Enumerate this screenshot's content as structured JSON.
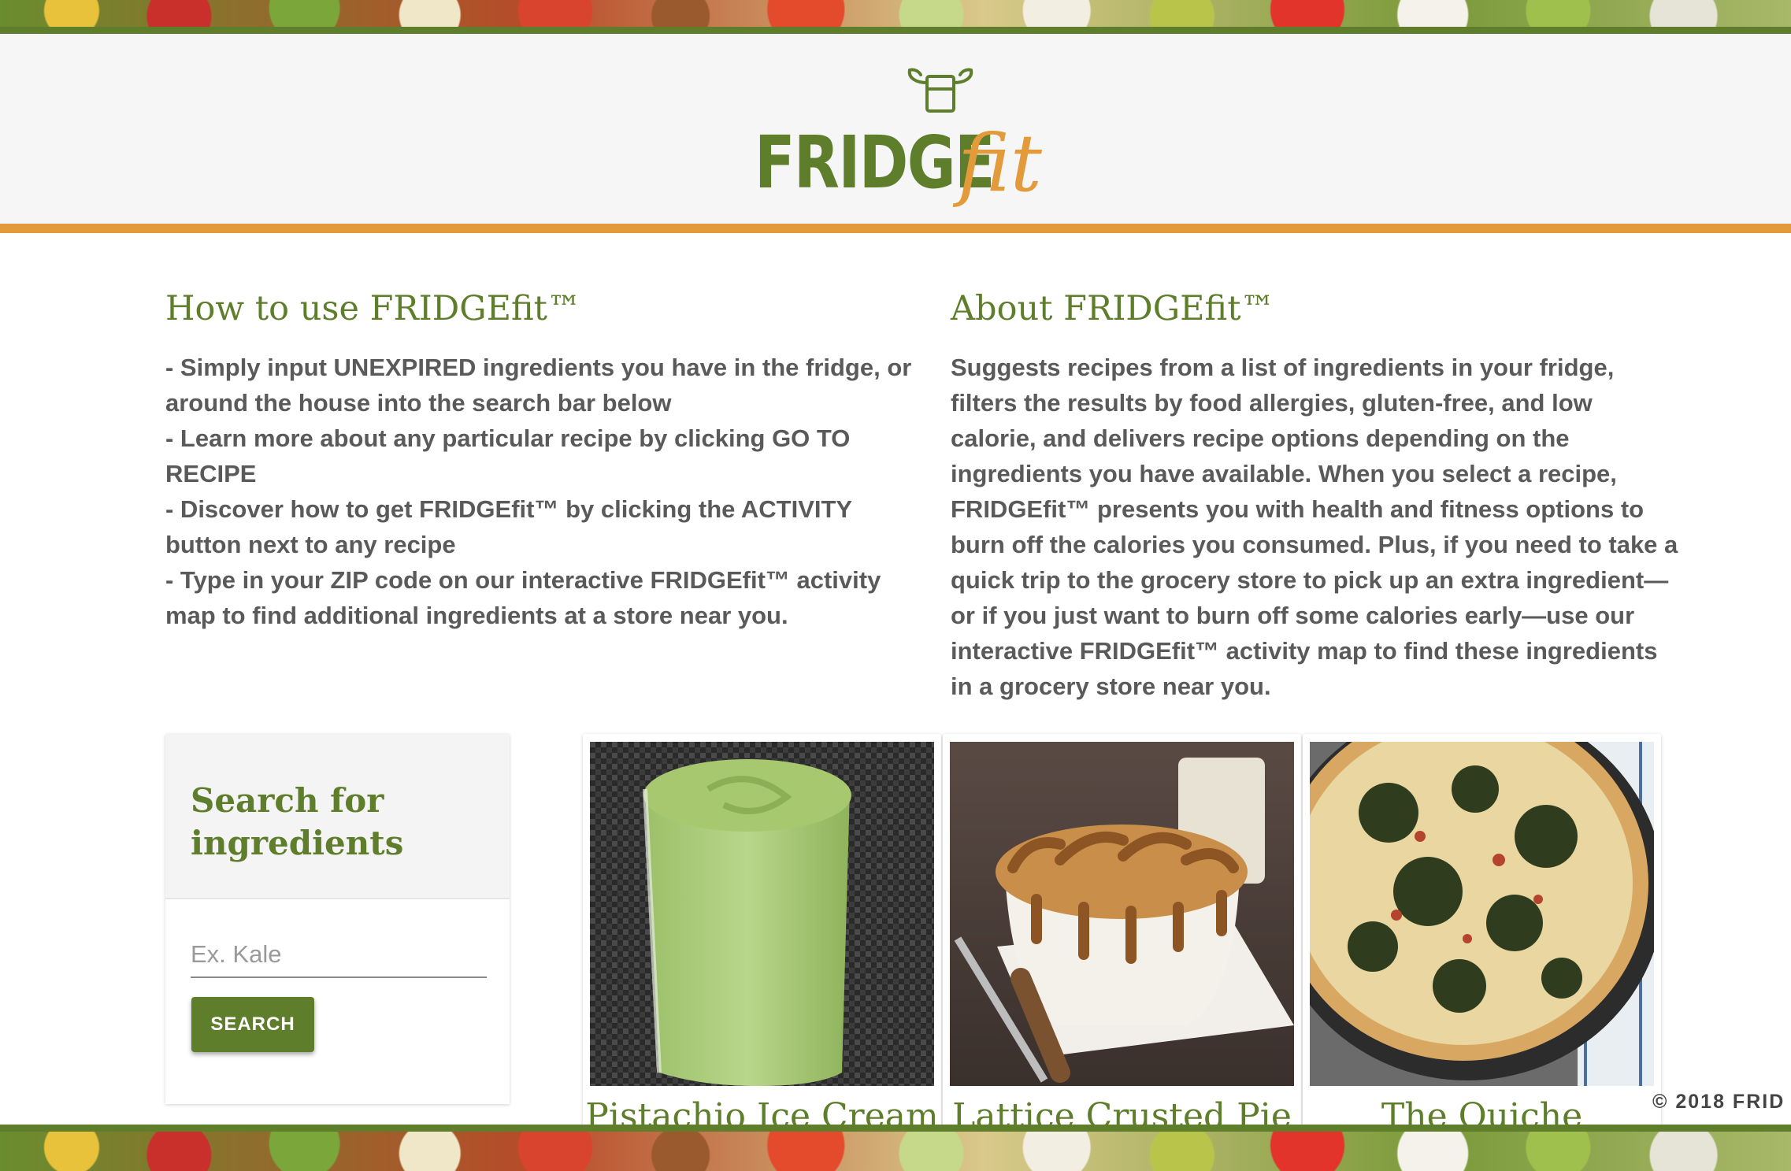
{
  "header": {
    "logo_text_main": "FRIDGE",
    "logo_text_accent": "fit"
  },
  "how_to": {
    "title": "How to use FRIDGEfit™",
    "lines": [
      "- Simply input UNEXPIRED ingredients you have in the fridge, or around the house into the search bar below",
      "- Learn more about any particular recipe by clicking GO TO RECIPE",
      "- Discover how to get FRIDGEfit™ by clicking the ACTIVITY button next to any recipe",
      "- Type in your ZIP code on our interactive FRIDGEfit™ activity map to find additional ingredients at a store near you."
    ]
  },
  "about": {
    "title": "About FRIDGEfit™",
    "text": "Suggests recipes from a list of ingredients in your fridge, filters the results by food allergies, gluten-free, and low calorie, and delivers recipe options depending on the ingredients you have available. When you select a recipe, FRIDGEfit™ presents you with health and fitness options to burn off the calories you consumed. Plus, if you need to take a quick trip to the grocery store to pick up an extra ingredient—or if you just want to burn off some calories early—use our interactive FRIDGEfit™ activity map to find these ingredients in a grocery store near you."
  },
  "search": {
    "title": "Search for ingredients",
    "placeholder": "Ex. Kale",
    "value": "",
    "button_label": "SEARCH"
  },
  "recipes": [
    {
      "title": "Pistachio Ice Cream",
      "image": "green-smoothie"
    },
    {
      "title": "Lattice Crusted Pie",
      "image": "pot-pie"
    },
    {
      "title": "The Quiche",
      "image": "kale-quiche"
    }
  ],
  "footer": {
    "copyright": "© 2018 FRID"
  },
  "colors": {
    "brand_green": "#5e7e2c",
    "brand_orange": "#e39a3b",
    "body_text": "#5a5a5a"
  }
}
